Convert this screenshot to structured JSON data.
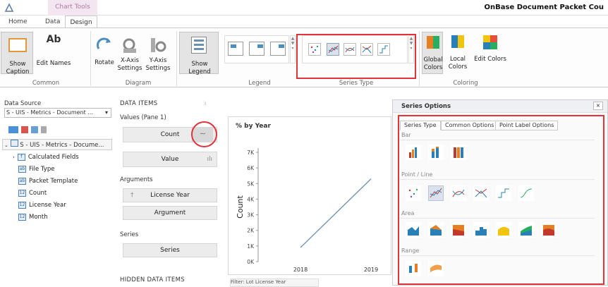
{
  "app": {
    "context_tab": "Chart Tools",
    "title": "OnBase Document Packet Cou"
  },
  "tabs": {
    "home": "Home",
    "data": "Data",
    "design": "Design"
  },
  "ribbon": {
    "show_caption": "Show Caption",
    "edit_names": "Edit Names",
    "rotate": "Rotate",
    "x_axis_1": "X-Axis",
    "x_axis_2": "Settings",
    "y_axis_1": "Y-Axis",
    "y_axis_2": "Settings",
    "show_legend": "Show Legend",
    "global_1": "Global",
    "global_2": "Colors",
    "local_1": "Local",
    "local_2": "Colors",
    "edit_colors": "Edit Colors",
    "groups": {
      "common": "Common",
      "diagram": "Diagram",
      "legend": "Legend",
      "series_type": "Series Type",
      "coloring": "Coloring"
    }
  },
  "left": {
    "data_source_label": "Data Source",
    "data_source_value": "S - UIS - Metrics - Document ...",
    "tree_root": "S - UIS - Metrics - Docume...",
    "fields": [
      "Calculated Fields",
      "File Type",
      "Packet Template",
      "Count",
      "License Year",
      "Month"
    ]
  },
  "middle": {
    "data_items": "DATA ITEMS",
    "values_pane": "Values (Pane 1)",
    "count": "Count",
    "value": "Value",
    "arguments": "Arguments",
    "license_year": "License Year",
    "argument": "Argument",
    "series": "Series",
    "series_btn": "Series",
    "hidden": "HIDDEN DATA ITEMS"
  },
  "chart": {
    "pane_title": "% by Year",
    "filter_label": "Filter: Lot License Year"
  },
  "chart_data": {
    "type": "line",
    "x": [
      "2018",
      "2019"
    ],
    "series": [
      {
        "values": [
          900,
          5300
        ]
      }
    ],
    "ylabel": "Count",
    "ylim": [
      0,
      7000
    ],
    "yticks": [
      "0K",
      "1K",
      "2K",
      "3K",
      "4K",
      "5K",
      "6K",
      "7K"
    ],
    "xticks": [
      "2018",
      "2019"
    ],
    "grid": false
  },
  "dialog": {
    "title": "Series Options",
    "close": "×",
    "tabs": [
      "Series Type",
      "Common Options",
      "Point Label Options"
    ],
    "categories": [
      "Bar",
      "Point / Line",
      "Area",
      "Range"
    ]
  },
  "colors": {
    "accent": "#e1343a",
    "line": "#6b8fb3",
    "ctx": "#f3e6f1"
  }
}
